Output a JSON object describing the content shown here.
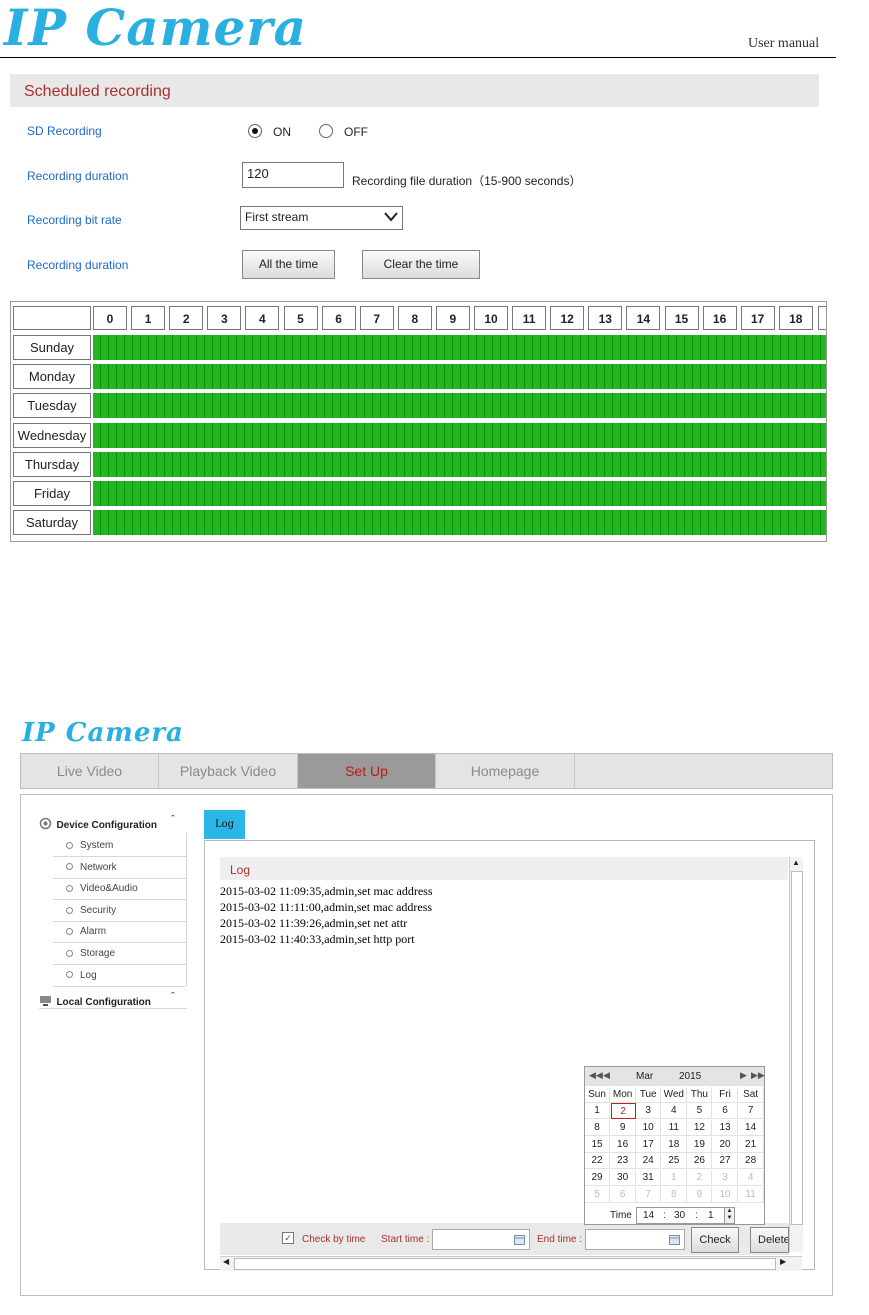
{
  "doc": {
    "logo_text": "IP Camera",
    "header_right": "User manual"
  },
  "scheduled": {
    "title": "Scheduled recording",
    "sd_recording_label": "SD Recording",
    "on_label": "ON",
    "off_label": "OFF",
    "selected": "ON",
    "duration_label": "Recording duration",
    "duration_value": "120",
    "duration_hint": "Recording file duration（15-900 seconds）",
    "bitrate_label": "Recording bit rate",
    "bitrate_value": "First stream",
    "duration2_label": "Recording duration",
    "all_time_button": "All the time",
    "clear_time_button": "Clear the time",
    "hours": [
      "0",
      "1",
      "2",
      "3",
      "4",
      "5",
      "6",
      "7",
      "8",
      "9",
      "10",
      "11",
      "12",
      "13",
      "14",
      "15",
      "16",
      "17",
      "18"
    ],
    "days": [
      "Sunday",
      "Monday",
      "Tuesday",
      "Wednesday",
      "Thursday",
      "Friday",
      "Saturday"
    ],
    "colors": {
      "scheduled": "#1fb81f",
      "title": "#a6322a",
      "label": "#2169c8"
    }
  },
  "app": {
    "logo_text": "IP Camera",
    "nav_tabs": [
      "Live Video",
      "Playback Video",
      "Set Up",
      "Homepage"
    ],
    "active_tab": "Set Up",
    "sidebar": {
      "device_config": "Device Configuration",
      "items": [
        "System",
        "Network",
        "Video&Audio",
        "Security",
        "Alarm",
        "Storage",
        "Log"
      ],
      "local_config": "Local Configuration"
    },
    "log_tab": "Log",
    "log_title": "Log",
    "log_lines": [
      "2015-03-02 11:09:35,admin,set mac address",
      "2015-03-02 11:11:00,admin,set mac address",
      "2015-03-02 11:39:26,admin,set net attr",
      "2015-03-02 11:40:33,admin,set http port"
    ],
    "calendar": {
      "month": "Mar",
      "year": "2015",
      "weekdays": [
        "Sun",
        "Mon",
        "Tue",
        "Wed",
        "Thu",
        "Fri",
        "Sat"
      ],
      "rows": [
        [
          "1",
          "2",
          "3",
          "4",
          "5",
          "6",
          "7"
        ],
        [
          "8",
          "9",
          "10",
          "11",
          "12",
          "13",
          "14"
        ],
        [
          "15",
          "16",
          "17",
          "18",
          "19",
          "20",
          "21"
        ],
        [
          "22",
          "23",
          "24",
          "25",
          "26",
          "27",
          "28"
        ],
        [
          "29",
          "30",
          "31",
          "1",
          "2",
          "3",
          "4"
        ],
        [
          "5",
          "6",
          "7",
          "8",
          "9",
          "10",
          "11"
        ]
      ],
      "selected_day": "2",
      "time_label": "Time",
      "time_h": "14",
      "time_m": "30",
      "time_s": "1"
    },
    "filter": {
      "check_by_time": "Check by time",
      "start_time": "Start time :",
      "end_time": "End time :",
      "check_button": "Check",
      "delete_button": "Delete"
    },
    "accent_color": "#2bb7e6"
  }
}
